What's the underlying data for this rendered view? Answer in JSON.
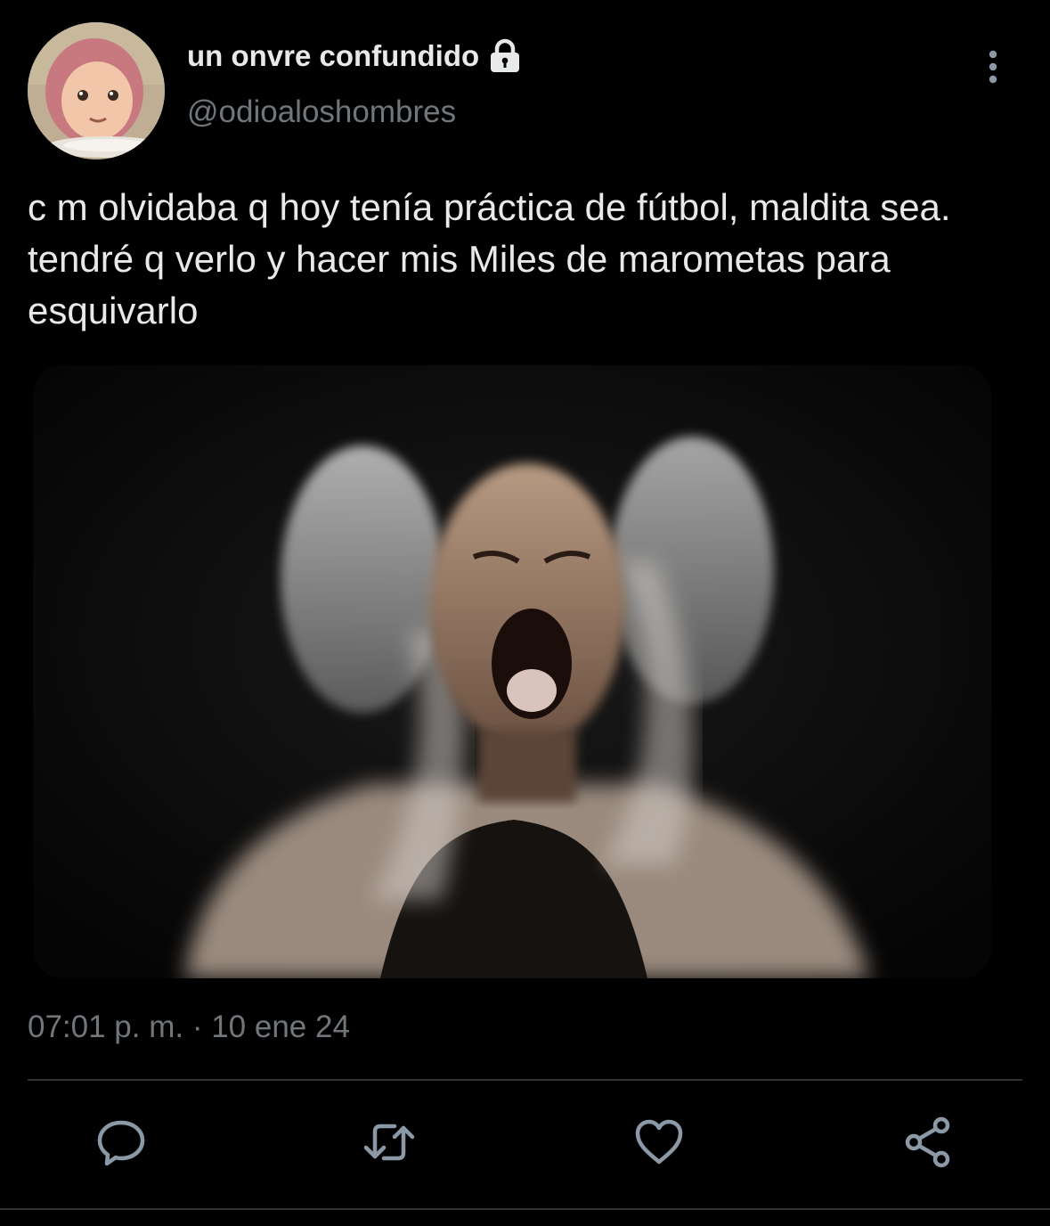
{
  "tweet": {
    "author": {
      "display_name": "un onvre confundido",
      "handle": "@odioaloshombres",
      "locked": true
    },
    "text": "c m olvidaba q hoy tenía práctica de fútbol, maldita sea. tendré q verlo y hacer mis Miles de marometas para esquivarlo",
    "timestamp": "07:01 p. m. · 10 ene 24"
  },
  "icons": {
    "lock": "lock-icon",
    "more": "more-vertical-icon",
    "reply": "reply-icon",
    "retweet": "retweet-icon",
    "like": "heart-icon",
    "share": "share-icon"
  },
  "colors": {
    "background": "#000000",
    "primary_text": "#e7e9ea",
    "secondary_text": "#71767b",
    "divider": "#2f3336",
    "icon": "#8b98a5"
  }
}
